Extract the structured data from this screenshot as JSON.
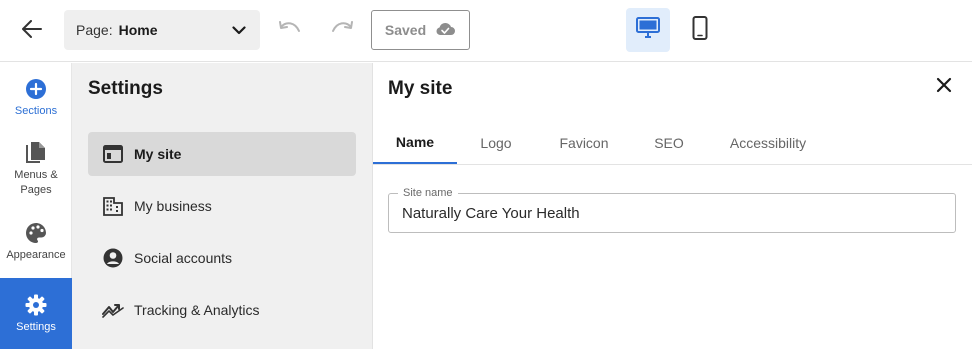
{
  "toolbar": {
    "page_label": "Page:",
    "page_value": "Home",
    "saved_label": "Saved",
    "icons": {
      "back": "arrow-left-icon",
      "dropdown": "chevron-down-icon",
      "undo": "undo-icon",
      "redo": "redo-icon",
      "saved": "cloud-check-icon",
      "desktop": "desktop-icon",
      "mobile": "mobile-icon"
    },
    "active_view": "desktop",
    "accent_color": "#2d6fd6"
  },
  "rail": {
    "items": [
      {
        "label": "Sections",
        "icon": "plus-circle-icon"
      },
      {
        "label": "Menus & Pages",
        "icon": "pages-icon"
      },
      {
        "label": "Appearance",
        "icon": "palette-icon"
      },
      {
        "label": "Settings",
        "icon": "gear-icon"
      }
    ],
    "active": "Settings"
  },
  "settings": {
    "title": "Settings",
    "items": [
      {
        "label": "My site",
        "icon": "browser-window-icon"
      },
      {
        "label": "My business",
        "icon": "building-icon"
      },
      {
        "label": "Social accounts",
        "icon": "user-circle-icon"
      },
      {
        "label": "Tracking & Analytics",
        "icon": "trend-icon"
      }
    ],
    "active": "My site"
  },
  "main": {
    "title": "My site",
    "close_icon": "close-icon",
    "tabs": [
      {
        "label": "Name"
      },
      {
        "label": "Logo"
      },
      {
        "label": "Favicon"
      },
      {
        "label": "SEO"
      },
      {
        "label": "Accessibility"
      }
    ],
    "active_tab": "Name",
    "site_name_field": {
      "label": "Site name",
      "value": "Naturally Care Your Health"
    }
  }
}
